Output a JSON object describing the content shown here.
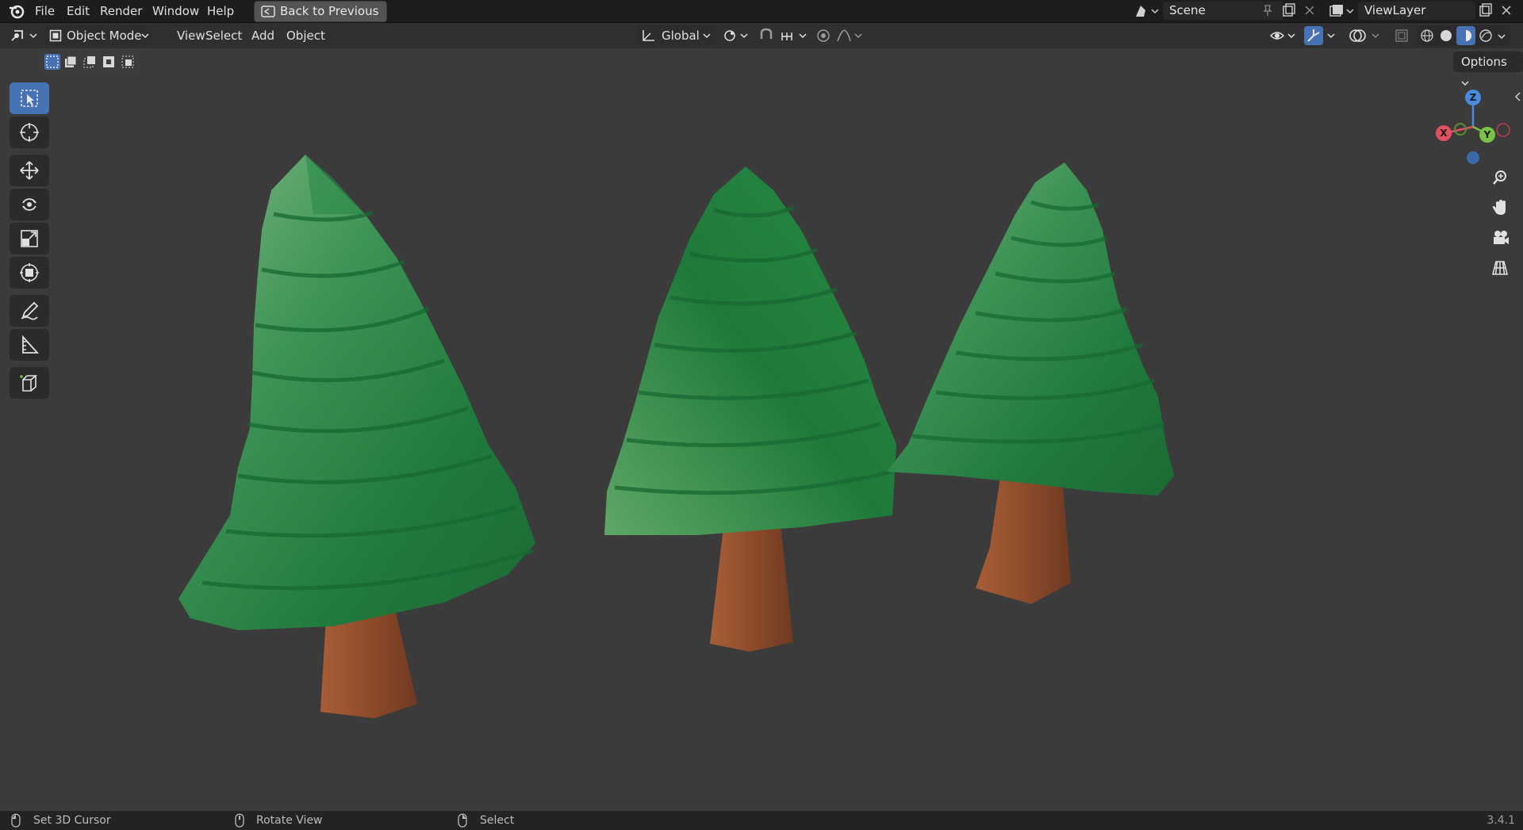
{
  "app": {
    "menu": [
      "File",
      "Edit",
      "Render",
      "Window",
      "Help"
    ],
    "back_button": "Back to Previous",
    "scene_label": "Scene",
    "viewlayer_label": "ViewLayer"
  },
  "header": {
    "mode": "Object Mode",
    "menus": [
      "View",
      "Select",
      "Add",
      "Object"
    ],
    "transform_orientation": "Global",
    "options": "Options"
  },
  "gizmo": {
    "axes": [
      "X",
      "Y",
      "Z"
    ]
  },
  "toolbar": {
    "tools": [
      {
        "name": "select-box-icon",
        "active": true
      },
      {
        "name": "cursor-icon",
        "active": false
      },
      {
        "name": "move-icon",
        "active": false
      },
      {
        "name": "rotate-icon",
        "active": false
      },
      {
        "name": "scale-icon",
        "active": false
      },
      {
        "name": "transform-icon",
        "active": false
      },
      {
        "name": "annotate-icon",
        "active": false
      },
      {
        "name": "measure-icon",
        "active": false
      },
      {
        "name": "add-cube-icon",
        "active": false
      }
    ]
  },
  "statusbar": {
    "left": "Set 3D Cursor",
    "middle": "Rotate View",
    "right": "Select",
    "version": "3.4.1"
  },
  "colors": {
    "accent": "#4772b3",
    "foliage_dark": "#1f7a3c",
    "foliage_light": "#6fae72",
    "trunk": "#8a4a2a"
  }
}
